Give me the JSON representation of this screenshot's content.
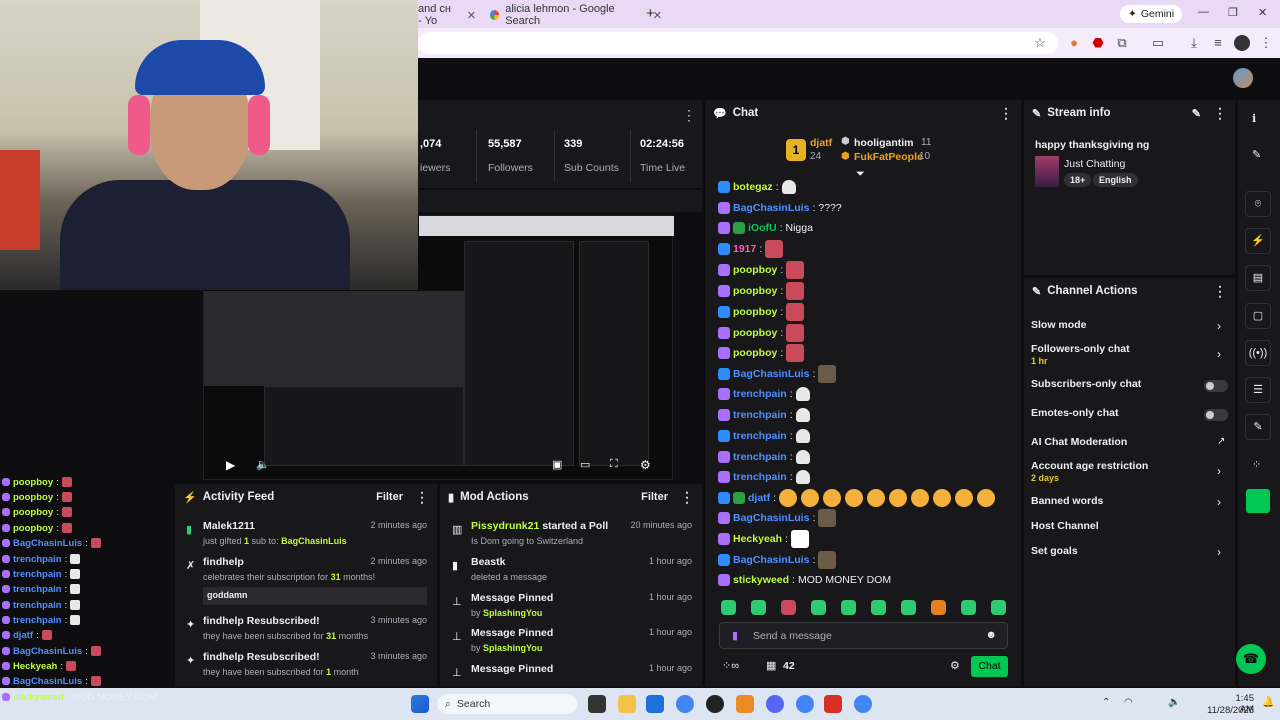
{
  "browser": {
    "tabs": [
      {
        "title": "and сн - Yo"
      },
      {
        "title": "alicia lehmon - Google Search"
      }
    ],
    "new_tab": "+",
    "gemini_label": "Gemini"
  },
  "stats": [
    {
      "value": ",074",
      "label": "iewers"
    },
    {
      "value": "55,587",
      "label": "Followers"
    },
    {
      "value": "339",
      "label": "Sub Counts"
    },
    {
      "value": "02:24:56",
      "label": "Time Live"
    }
  ],
  "chat": {
    "title": "Chat",
    "leaderboard": [
      {
        "rank": "1",
        "name": "djatf",
        "count": "24"
      },
      {
        "name": "hooligantim",
        "count": "11"
      },
      {
        "name": "FukFatPeople",
        "count": "10"
      }
    ],
    "messages": [
      {
        "user": "botegaz",
        "color": "#bfff3f",
        "text": ""
      },
      {
        "user": "BagChasinLuis",
        "color": "#4f8fff",
        "text": "????"
      },
      {
        "user": "iOofU",
        "color": "#00c853",
        "text": "Nigga"
      },
      {
        "user": "1917",
        "color": "#ff5cbe",
        "text": ""
      },
      {
        "user": "poopboy",
        "color": "#bfff3f",
        "text": ""
      },
      {
        "user": "poopboy",
        "color": "#bfff3f",
        "text": ""
      },
      {
        "user": "poopboy",
        "color": "#bfff3f",
        "text": ""
      },
      {
        "user": "poopboy",
        "color": "#bfff3f",
        "text": ""
      },
      {
        "user": "poopboy",
        "color": "#bfff3f",
        "text": ""
      },
      {
        "user": "BagChasinLuis",
        "color": "#4f8fff",
        "text": ""
      },
      {
        "user": "trenchpain",
        "color": "#4f8fff",
        "text": ""
      },
      {
        "user": "trenchpain",
        "color": "#4f8fff",
        "text": ""
      },
      {
        "user": "trenchpain",
        "color": "#4f8fff",
        "text": ""
      },
      {
        "user": "trenchpain",
        "color": "#4f8fff",
        "text": ""
      },
      {
        "user": "trenchpain",
        "color": "#4f8fff",
        "text": ""
      },
      {
        "user": "djatf",
        "color": "#4f8fff",
        "text": ""
      },
      {
        "user": "BagChasinLuis",
        "color": "#4f8fff",
        "text": ""
      },
      {
        "user": "Heckyeah",
        "color": "#bfff3f",
        "text": ""
      },
      {
        "user": "BagChasinLuis",
        "color": "#4f8fff",
        "text": ""
      },
      {
        "user": "stickyweed",
        "color": "#bfff3f",
        "text": "MOD MONEY DOM"
      }
    ],
    "input_placeholder": "Send a message",
    "points": "42",
    "send_label": "Chat"
  },
  "stream_info": {
    "title": "Stream info",
    "stream_title": "happy thanksgiving ng",
    "category": "Just Chatting",
    "tags": [
      "18+",
      "English"
    ]
  },
  "channel_actions": {
    "title": "Channel Actions",
    "items": [
      {
        "label": "Slow mode",
        "sub": ""
      },
      {
        "label": "Followers-only chat",
        "sub": "1 hr"
      },
      {
        "label": "Subscribers-only chat",
        "sub": ""
      },
      {
        "label": "Emotes-only chat",
        "sub": ""
      },
      {
        "label": "AI Chat Moderation",
        "sub": ""
      },
      {
        "label": "Account age restriction",
        "sub": "2 days"
      },
      {
        "label": "Banned words",
        "sub": ""
      },
      {
        "label": "Host Channel",
        "sub": ""
      },
      {
        "label": "Set goals",
        "sub": ""
      }
    ]
  },
  "activity_feed": {
    "title": "Activity Feed",
    "filter": "Filter",
    "items": [
      {
        "title": "Malek1211",
        "sub_pre": "just gifted ",
        "sub_num": "1",
        "sub_mid": " sub to: ",
        "sub_user": "BagChasinLuis",
        "time": "2 minutes ago"
      },
      {
        "title": "findhelp",
        "sub_pre": "celebrates their subscription for ",
        "sub_num": "31",
        "sub_mid": " months!",
        "sub_user": "",
        "message": "goddamn",
        "time": "2 minutes ago"
      },
      {
        "title": "findhelp Resubscribed!",
        "sub_pre": "they have been subscribed for ",
        "sub_num": "31",
        "sub_mid": " months",
        "sub_user": "",
        "time": "3 minutes ago"
      },
      {
        "title": "findhelp Resubscribed!",
        "sub_pre": "they have been subscribed for ",
        "sub_num": "1",
        "sub_mid": " month",
        "sub_user": "",
        "time": "3 minutes ago"
      }
    ]
  },
  "mod_actions": {
    "title": "Mod Actions",
    "filter": "Filter",
    "items": [
      {
        "title_hl": "Pissydrunk21",
        "title_rest": " started a Poll",
        "sub": "Is Dom going to Switzerland",
        "sub_user": "",
        "time": "20 minutes ago"
      },
      {
        "title_hl": "",
        "title_rest": "Beastk",
        "sub": "deleted a message",
        "sub_user": "",
        "time": "1 hour ago"
      },
      {
        "title_hl": "",
        "title_rest": "Message Pinned",
        "sub": "by ",
        "sub_user": "SplashingYou",
        "time": "1 hour ago"
      },
      {
        "title_hl": "",
        "title_rest": "Message Pinned",
        "sub": "by ",
        "sub_user": "SplashingYou",
        "time": "1 hour ago"
      },
      {
        "title_hl": "",
        "title_rest": "Message Pinned",
        "sub": "",
        "sub_user": "",
        "time": "1 hour ago"
      }
    ]
  },
  "overlay_chat": [
    {
      "user": "poopboy",
      "text": ""
    },
    {
      "user": "poopboy",
      "text": ""
    },
    {
      "user": "poopboy",
      "text": ""
    },
    {
      "user": "poopboy",
      "text": ""
    },
    {
      "user": "BagChasinLuis",
      "text": ""
    },
    {
      "user": "trenchpain",
      "text": ""
    },
    {
      "user": "trenchpain",
      "text": ""
    },
    {
      "user": "trenchpain",
      "text": ""
    },
    {
      "user": "trenchpain",
      "text": ""
    },
    {
      "user": "trenchpain",
      "text": ""
    },
    {
      "user": "djatf",
      "text": ""
    },
    {
      "user": "BagChasinLuis",
      "text": ""
    },
    {
      "user": "Heckyeah",
      "text": ""
    },
    {
      "user": "BagChasinLuis",
      "text": ""
    },
    {
      "user": "stickyweed",
      "text": "MOD MONEY DOM"
    }
  ],
  "taskbar": {
    "search": "Search",
    "time": "1:45 AM",
    "date": "11/28/2025"
  }
}
